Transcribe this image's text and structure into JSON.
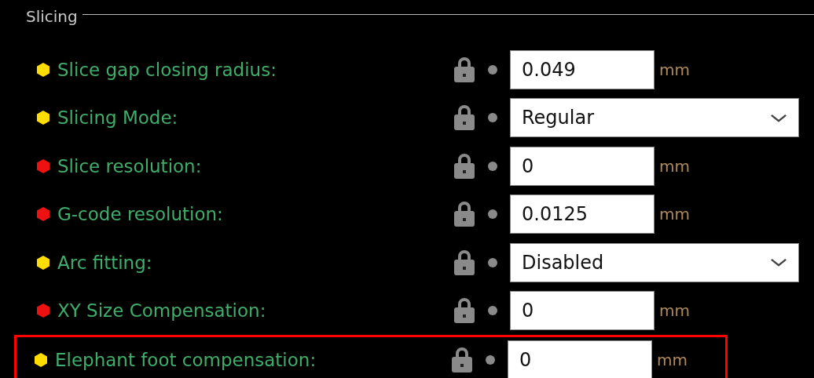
{
  "section": {
    "title": "Slicing"
  },
  "rows": [
    {
      "label": "Slice gap closing radius:",
      "color": "#ffdd00",
      "kind": "number",
      "value": "0.049",
      "unit": "mm",
      "highlighted": false
    },
    {
      "label": "Slicing Mode:",
      "color": "#ffdd00",
      "kind": "dropdown",
      "value": "Regular",
      "highlighted": false
    },
    {
      "label": "Slice resolution:",
      "color": "#ee1111",
      "kind": "number",
      "value": "0",
      "unit": "mm",
      "highlighted": false
    },
    {
      "label": "G-code resolution:",
      "color": "#ee1111",
      "kind": "number",
      "value": "0.0125",
      "unit": "mm",
      "highlighted": false
    },
    {
      "label": "Arc fitting:",
      "color": "#ffdd00",
      "kind": "dropdown",
      "value": "Disabled",
      "highlighted": false
    },
    {
      "label": "XY Size Compensation:",
      "color": "#ee1111",
      "kind": "number",
      "value": "0",
      "unit": "mm",
      "highlighted": false
    },
    {
      "label": "Elephant foot compensation:",
      "color": "#ffdd00",
      "kind": "number",
      "value": "0",
      "unit": "mm",
      "highlighted": true
    }
  ]
}
